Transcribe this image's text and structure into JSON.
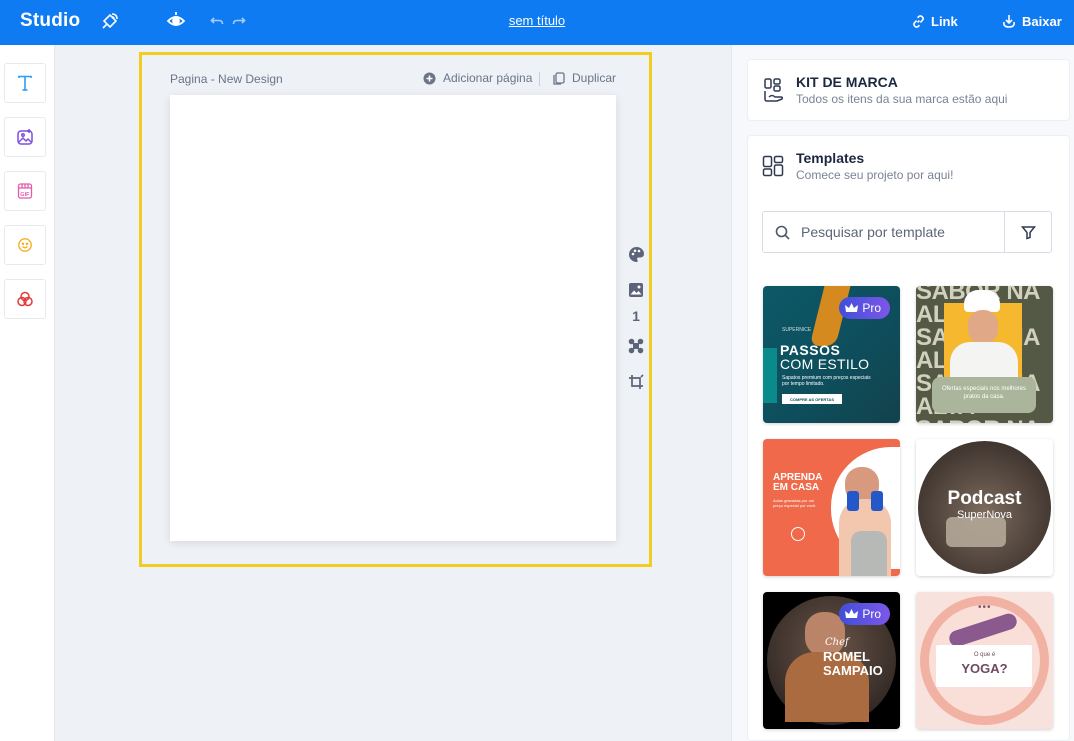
{
  "topbar": {
    "brand": "Studio",
    "doc_title": "sem título",
    "link_label": "Link",
    "download_label": "Baixar"
  },
  "left_tools": [
    {
      "name": "text-tool",
      "icon": "text-icon",
      "color": "#2a9df4"
    },
    {
      "name": "image-tool",
      "icon": "image-sparkle-icon",
      "color": "#7b4de0"
    },
    {
      "name": "gif-tool",
      "icon": "gif-icon",
      "color": "#e25dac"
    },
    {
      "name": "emoji-tool",
      "icon": "smiley-icon",
      "color": "#f0b22a"
    },
    {
      "name": "shapes-tool",
      "icon": "shapes-icon",
      "color": "#e23a3a"
    }
  ],
  "canvas": {
    "page_label": "Pagina - New Design",
    "add_page_label": "Adicionar página",
    "duplicate_label": "Duplicar",
    "page_number": "1"
  },
  "brand_kit": {
    "title": "KIT DE MARCA",
    "subtitle": "Todos os itens da sua marca estão aqui"
  },
  "templates": {
    "title": "Templates",
    "subtitle": "Comece seu projeto por aqui!",
    "search_placeholder": "Pesquisar por template",
    "items": [
      {
        "pro": "Pro",
        "small": "SUPERNICE",
        "headline_1": "PASSOS",
        "headline_2": "COM ESTILO",
        "body": "Sapatos premium com preços especiais por tempo limitado.",
        "cta": "COMPRE AS OFERTAS"
      },
      {
        "bg_word": "SABOR NA ALTA",
        "caption": "Ofertas especiais nos melhores pratos da casa."
      },
      {
        "headline_1": "APRENDA",
        "headline_2": "EM CASA",
        "body": "Aulas gravadas por um preço especial por você."
      },
      {
        "title": "Podcast",
        "subtitle": "SuperNova"
      },
      {
        "pro": "Pro",
        "script": "Chef",
        "name_1": "ROMEL",
        "name_2": "SAMPAIO"
      },
      {
        "question": "O que é",
        "title": "YOGA?"
      }
    ]
  },
  "colors": {
    "primary": "#0f7bf2",
    "selection": "#f2cd1e",
    "pro_badge": "#5a51e0"
  }
}
